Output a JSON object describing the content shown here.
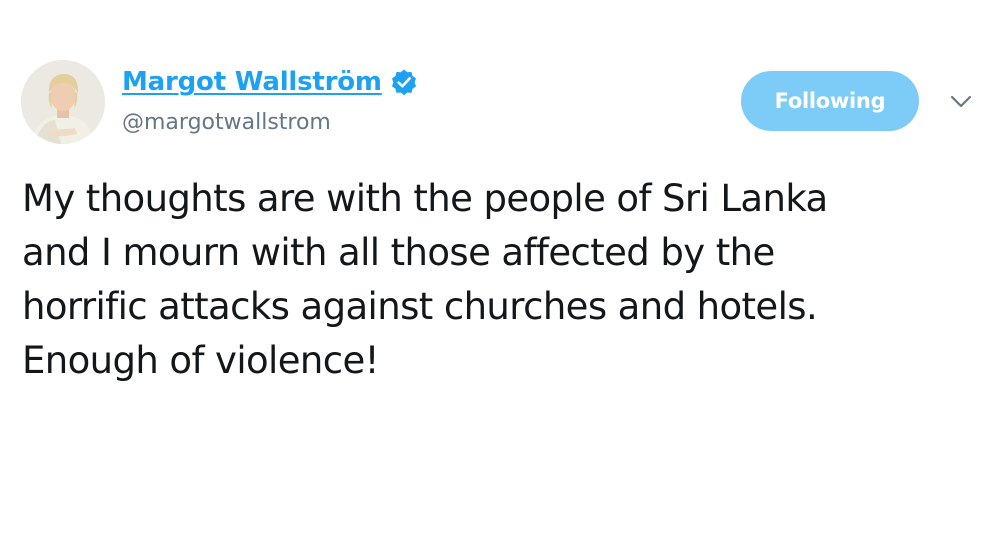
{
  "user": {
    "display_name": "Margot Wallström",
    "handle": "@margotwallstrom",
    "verified": true,
    "avatar_icon": "profile-photo"
  },
  "actions": {
    "follow_label": "Following",
    "menu_icon": "chevron-down-icon"
  },
  "tweet": {
    "lines": [
      "My thoughts are with the people of Sri Lanka",
      "and I mourn with all those affected by the",
      "horrific attacks against churches and hotels.",
      "Enough of violence!"
    ]
  },
  "colors": {
    "accent": "#1da1f2",
    "button_bg": "#7cccf7",
    "handle_text": "#657786",
    "body_text": "#14171a"
  }
}
